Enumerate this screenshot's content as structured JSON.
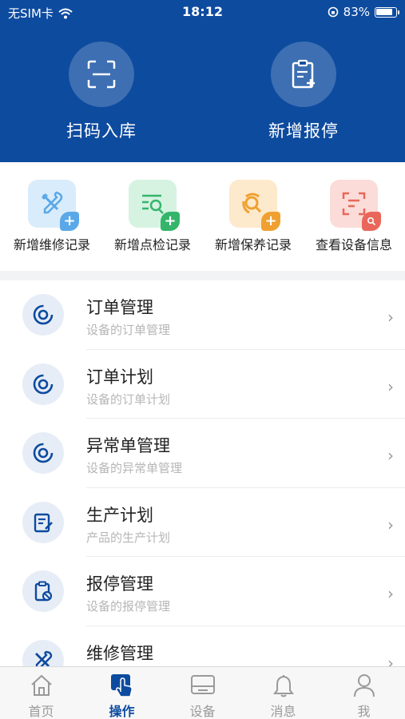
{
  "status_bar": {
    "carrier": "无SIM卡",
    "time": "18:12",
    "battery": "83%"
  },
  "hero": [
    {
      "label": "扫码入库"
    },
    {
      "label": "新增报停"
    }
  ],
  "quick_actions": [
    {
      "label": "新增维修记录",
      "color": "#5aa8e8",
      "bg": "#d9ecfb"
    },
    {
      "label": "新增点检记录",
      "color": "#34b56a",
      "bg": "#d6f3e2"
    },
    {
      "label": "新增保养记录",
      "color": "#f0a030",
      "bg": "#fde9cc"
    },
    {
      "label": "查看设备信息",
      "color": "#e9675a",
      "bg": "#fbdcd8"
    }
  ],
  "menu": [
    {
      "title": "订单管理",
      "subtitle": "设备的订单管理"
    },
    {
      "title": "订单计划",
      "subtitle": "设备的订单计划"
    },
    {
      "title": "异常单管理",
      "subtitle": "设备的异常单管理"
    },
    {
      "title": "生产计划",
      "subtitle": "产品的生产计划"
    },
    {
      "title": "报停管理",
      "subtitle": "设备的报停管理"
    },
    {
      "title": "维修管理",
      "subtitle": ""
    }
  ],
  "tabs": [
    {
      "label": "首页"
    },
    {
      "label": "操作"
    },
    {
      "label": "设备"
    },
    {
      "label": "消息"
    },
    {
      "label": "我"
    }
  ],
  "colors": {
    "primary": "#0d4b9f"
  }
}
